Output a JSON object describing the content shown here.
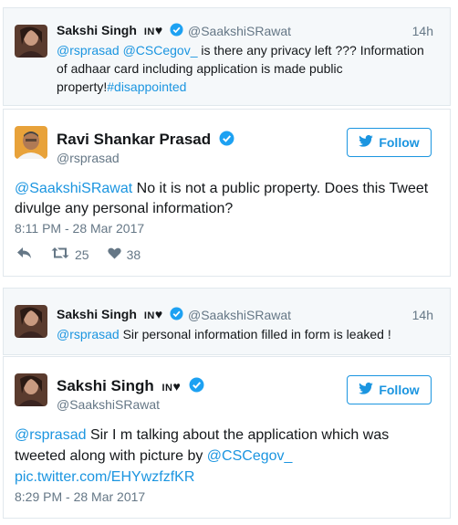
{
  "tweet1": {
    "name": "Sakshi Singh",
    "flag": "IN",
    "heart": "♥",
    "handle": "@SaakshiSRawat",
    "time": "14h",
    "mention1": "@rsprasad",
    "mention2": "@CSCegov_",
    "text_line1": " is there any privacy left ??? Information",
    "text_line2": "of adhaar card including application is made public",
    "text_line3": "property!",
    "hashtag": "#disappointed"
  },
  "tweet2": {
    "name": "Ravi Shankar Prasad",
    "handle": "@rsprasad",
    "follow_label": "Follow",
    "mention": "@SaakshiSRawat",
    "text_line1": " No it is not a public property. Does this Tweet",
    "text_line2": "divulge any personal information?",
    "timestamp": "8:11 PM - 28 Mar 2017",
    "retweets": "25",
    "likes": "38"
  },
  "tweet3": {
    "name": "Sakshi Singh",
    "flag": "IN",
    "heart": "♥",
    "handle": "@SaakshiSRawat",
    "time": "14h",
    "mention": "@rsprasad",
    "text": " Sir personal information filled in form is leaked !"
  },
  "tweet4": {
    "name": "Sakshi Singh",
    "flag": "IN",
    "heart": "♥",
    "handle": "@SaakshiSRawat",
    "follow_label": "Follow",
    "mention1": "@rsprasad",
    "text_line1": " Sir I m talking about the application which was",
    "text_line2": "tweeted along with picture by ",
    "mention2": "@CSCegov_",
    "link": "pic.twitter.com/EHYwzfzfKR",
    "timestamp": "8:29 PM - 28 Mar 2017"
  },
  "colors": {
    "link": "#1b95e0",
    "muted": "#657786",
    "context_bg": "#f5f8fa",
    "verified": "#1da1f2"
  }
}
